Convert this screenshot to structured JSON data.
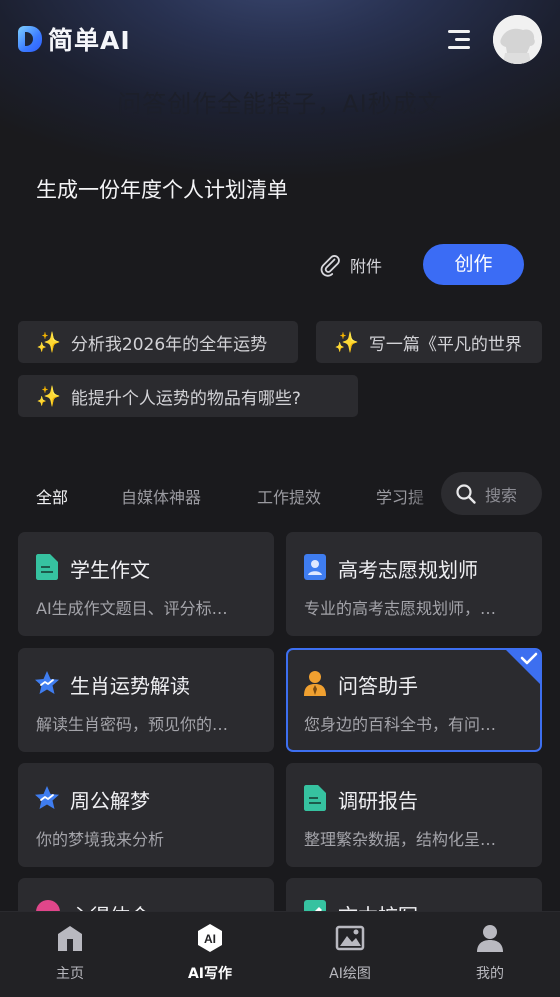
{
  "header": {
    "logo_text": "简单AI",
    "menu_icon": "menu-icon",
    "avatar_icon": "avatar"
  },
  "hero": {
    "title": "问答创作全能搭子，AI秒成文",
    "prompt": "生成一份年度个人计划清单",
    "attach_label": "附件",
    "create_label": "创作"
  },
  "suggestions": [
    {
      "icon": "sparkle-icon",
      "text": "分析我2026年的全年运势"
    },
    {
      "icon": "sparkle-icon",
      "text": "写一篇《平凡的世界"
    },
    {
      "icon": "sparkle-icon",
      "text": "能提升个人运势的物品有哪些?"
    }
  ],
  "category_tabs": [
    {
      "label": "全部",
      "active": true
    },
    {
      "label": "自媒体神器",
      "active": false
    },
    {
      "label": "工作提效",
      "active": false
    },
    {
      "label": "学习提",
      "active": false
    }
  ],
  "search": {
    "placeholder": "搜索"
  },
  "cards": [
    {
      "title": "学生作文",
      "desc": "AI生成作文题目、评分标…",
      "icon": "document-icon",
      "color": "#36c2a0"
    },
    {
      "title": "高考志愿规划师",
      "desc": "专业的高考志愿规划师，…",
      "icon": "profile-card-icon",
      "color": "#3f7df0"
    },
    {
      "title": "生肖运势解读",
      "desc": "解读生肖密码，预见你的…",
      "icon": "star-icon",
      "color": "#3f7df0"
    },
    {
      "title": "问答助手",
      "desc": "您身边的百科全书，有问…",
      "icon": "person-icon",
      "color": "#f0a030",
      "selected": true
    },
    {
      "title": "周公解梦",
      "desc": "你的梦境我来分析",
      "icon": "star-icon",
      "color": "#3f7df0"
    },
    {
      "title": "调研报告",
      "desc": "整理繁杂数据，结构化呈…",
      "icon": "document-icon",
      "color": "#36c2a0"
    },
    {
      "title": "心得体会",
      "desc": "",
      "icon": "minus-circle-icon",
      "color": "#e0468a"
    },
    {
      "title": "文本扩写",
      "desc": "",
      "icon": "pencil-icon",
      "color": "#36c2a0"
    }
  ],
  "bottom_nav": [
    {
      "label": "主页",
      "icon": "home-icon",
      "active": false
    },
    {
      "label": "AI写作",
      "icon": "ai-write-icon",
      "active": true
    },
    {
      "label": "AI绘图",
      "icon": "image-icon",
      "active": false
    },
    {
      "label": "我的",
      "icon": "user-icon",
      "active": false
    }
  ]
}
